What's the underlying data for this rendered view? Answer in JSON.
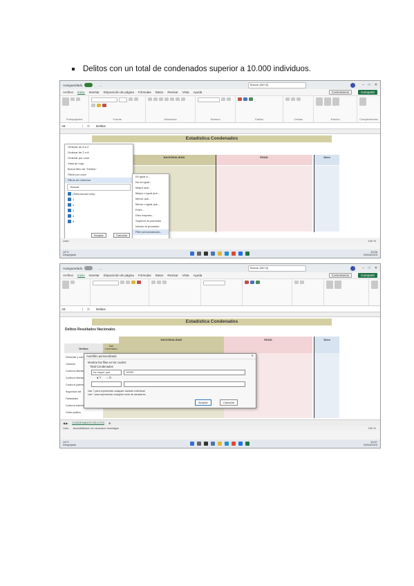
{
  "heading": {
    "bullet_text": "Delitos con un total de condenados superior a 10.000 individuos."
  },
  "colors": {
    "excel_green": "#217346",
    "tan_header": "#cfcaa1",
    "pink_header": "#f2d4d6",
    "blue_header": "#d7e3f0",
    "title_band": "#d4cfa3"
  },
  "screenshot1": {
    "titlebar": {
      "autosave": "Autoguardado",
      "filename": "…",
      "search_placeholder": "Buscar (Alt+Q)"
    },
    "menu": {
      "tabs": [
        "Archivo",
        "Inicio",
        "Insertar",
        "Disposición de página",
        "Fórmulas",
        "Datos",
        "Revisar",
        "Vista",
        "Ayuda"
      ],
      "comments": "Comentarios",
      "share": "Compartir"
    },
    "ribbon_groups": [
      "Portapapeles",
      "Fuente",
      "Alineación",
      "Número",
      "Estilos",
      "Celdas",
      "Edición",
      "Complementos"
    ],
    "formula": {
      "namebox": "A5",
      "fx": "fx",
      "value": "Delitos"
    },
    "sheet_title": "Estadística Condenados",
    "headers": {
      "nacionalidad": "NACIONALIDAD",
      "edad": "EDAD",
      "sexo": "Sexo"
    },
    "filter_menu": {
      "items": [
        "Ordenar de A a Z",
        "Ordenar de Z a A",
        "Ordenar por color",
        "Vista de hoja",
        "Borrar filtro de \"Delitos\"",
        "Filtrar por color",
        "Filtros de números"
      ],
      "submenu": [
        "Es igual a...",
        "No es igual...",
        "Mayor que...",
        "Mayor o igual que...",
        "Menor que...",
        "Menor o igual que...",
        "Entre...",
        "Diez mejores...",
        "Superior al promedio",
        "Inferior al promedio",
        "Filtro personalizado..."
      ],
      "search_label": "Buscar",
      "checks": [
        "(Seleccionar todo)",
        "1",
        "2",
        "3",
        "4",
        "5"
      ],
      "ok": "Aceptar",
      "cancel": "Cancelar"
    },
    "status": {
      "ready": "Listo",
      "accessibility": "Accesibilidad: es necesario investigar",
      "zoom": "100 %"
    },
    "taskbar": {
      "weather_temp": "14°C",
      "weather_desc": "Despejado",
      "time": "10:56",
      "date": "20/04/2023"
    }
  },
  "screenshot2": {
    "titlebar": {
      "autosave": "Autoguardado",
      "filename": "…",
      "search_placeholder": "Buscar (Alt+Q)"
    },
    "menu": {
      "tabs": [
        "Archivo",
        "Inicio",
        "Insertar",
        "Disposición de página",
        "Fórmulas",
        "Datos",
        "Revisar",
        "Vista",
        "Ayuda"
      ],
      "comments": "Comentarios",
      "share": "Compartir"
    },
    "formula": {
      "namebox": "A5",
      "fx": "fx",
      "value": "Delitos"
    },
    "sheet_title": "Estadística Condenados",
    "subtitle": "Delitos Resultados Nacionales",
    "headers": {
      "nacionalidad": "NACIONALIDAD",
      "edad": "EDAD",
      "sexo": "Sexo",
      "first_col": "Delitos",
      "total": "Total Condenados"
    },
    "row_labels": [
      "Homicidio y sus formas",
      "Lesiones",
      "Contra la libertad",
      "Contra la libertad sexual",
      "Contra el patrimonio",
      "Seguridad vial",
      "Falsedades",
      "Contra la Administración",
      "Orden público"
    ],
    "dialog": {
      "title": "Autofiltro personalizado",
      "show_rows": "Mostrar las filas en las cuales:",
      "field": "Total Condenados",
      "operator": "es mayor que",
      "value": "10000",
      "and_label": "Y",
      "or_label": "O",
      "hint1": "Use ? para representar cualquier carácter individual",
      "hint2": "Use * para representar cualquier serie de caracteres",
      "ok": "Aceptar",
      "cancel": "Cancelar"
    },
    "sheet_tab": "CONDENADOS DELITOS",
    "status": {
      "ready": "Listo",
      "accessibility": "Accesibilidad: es necesario investigar",
      "zoom": "100 %"
    },
    "taskbar": {
      "weather_temp": "14°C",
      "weather_desc": "Despejado",
      "time": "10:57",
      "date": "20/04/2023"
    }
  }
}
